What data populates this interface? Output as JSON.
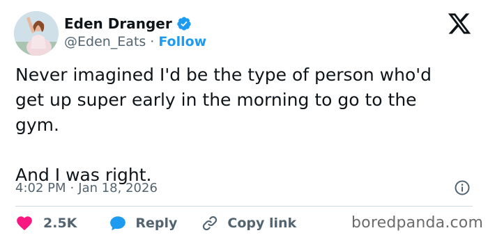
{
  "author": {
    "display_name": "Eden Dranger",
    "handle": "@Eden_Eats",
    "separator": "·",
    "follow_label": "Follow",
    "verified": true
  },
  "tweet": {
    "text": "Never imagined I'd be the type of person who'd\nget up super early in the morning to go to the\ngym.\n\nAnd I was right.",
    "time": "4:02 PM",
    "date": "Jan 18, 2026",
    "meta_separator": "·"
  },
  "actions": {
    "like_count": "2.5K",
    "reply_label": "Reply",
    "copy_link_label": "Copy link"
  },
  "watermark": "boredpanda.com",
  "icons": {
    "verified": "verified-badge-icon",
    "x_logo": "x-logo-icon",
    "info": "info-icon",
    "like": "heart-icon",
    "reply": "chat-bubble-icon",
    "copy_link": "link-icon"
  },
  "colors": {
    "accent": "#1d9bf0",
    "like": "#f91880",
    "text": "#0f1419",
    "secondary_text": "#536471"
  }
}
